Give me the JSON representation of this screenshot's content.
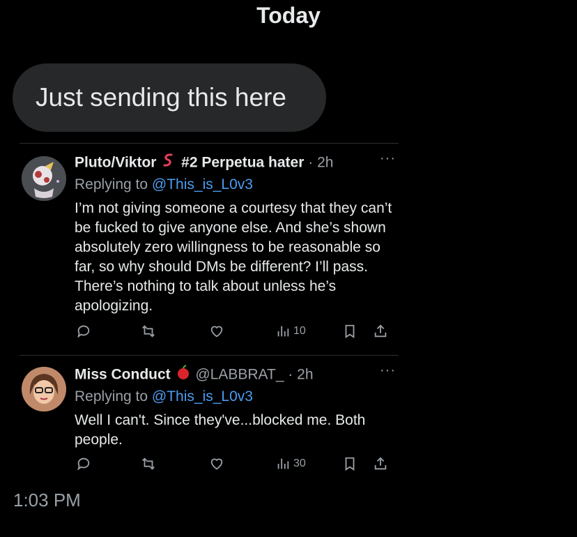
{
  "date_header": "Today",
  "message": {
    "text": "Just sending this here"
  },
  "tweets": [
    {
      "name": "Pluto/Viktor",
      "name_suffix": "#2 Perpetua hater",
      "handle": "",
      "time": "2h",
      "replying_prefix": "Replying to",
      "replying_to": "@This_is_L0v3",
      "text": "I’m not giving someone a courtesy that they can’t be fucked to give anyone else. And she’s shown absolutely zero willingness to be reasonable so far, so why should DMs be different? I’ll pass. There’s nothing to talk about unless he’s apologizing.",
      "views": "10"
    },
    {
      "name": "Miss Conduct",
      "name_suffix": "",
      "handle": "@LABBRAT_",
      "time": "2h",
      "replying_prefix": "Replying to",
      "replying_to": "@This_is_L0v3",
      "text": "Well I can't. Since they've...blocked me. Both people.",
      "views": "30"
    }
  ],
  "timestamp": "1:03 PM",
  "colors": {
    "background": "#000000",
    "bubble": "#26282a",
    "mention": "#4c9cf0",
    "muted": "#9aa0a6"
  }
}
